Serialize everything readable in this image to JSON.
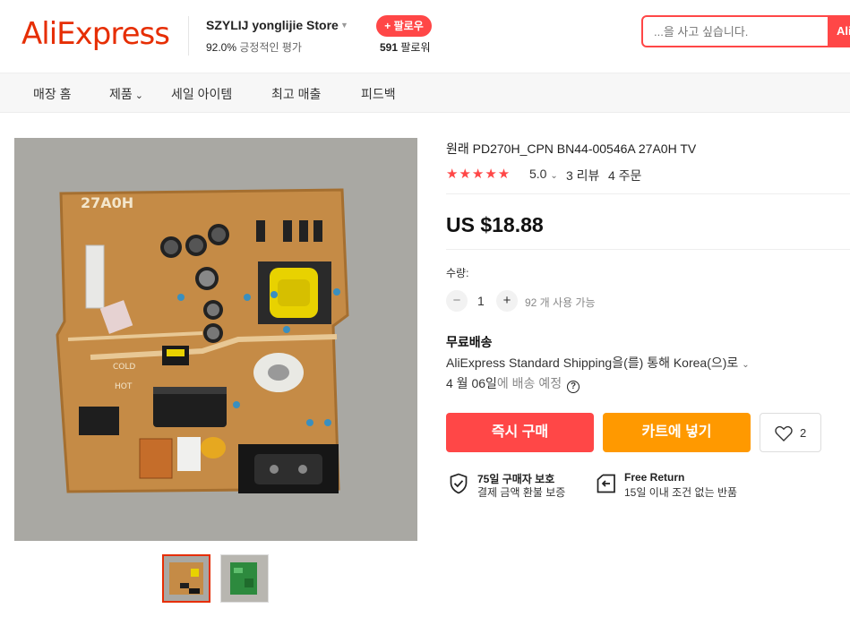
{
  "header": {
    "logo": "AliExpress",
    "store_name": "SZYLIJ yonglijie Store",
    "store_rating_value": "92.0%",
    "store_rating_label": "긍정적인 평가",
    "follow_label": "+ 팔로우",
    "followers_count": "591",
    "followers_label": "팔로워",
    "search_placeholder": "...을 사고 싶습니다.",
    "search_button": "Ali"
  },
  "nav": {
    "items": [
      "매장 홈",
      "제품",
      "세일 아이템",
      "최고 매출",
      "피드백"
    ]
  },
  "product": {
    "title": "원래 PD270H_CPN BN44-00546A 27A0H TV",
    "stars": "★★★★★",
    "rating": "5.0",
    "reviews": "3 리뷰",
    "orders": "4 주문",
    "price": "US $18.88",
    "quantity_label": "수량:",
    "quantity_minus": "−",
    "quantity_value": "1",
    "quantity_plus": "+",
    "quantity_available": "92 개 사용 가능",
    "shipping_title": "무료배송",
    "shipping_desc": "AliExpress Standard Shipping을(를) 통해 Korea(으)로",
    "shipping_date": "4 월 06일",
    "shipping_date_suffix": "에 배송 예정",
    "buy_now": "즉시 구매",
    "add_to_cart": "카트에 넣기",
    "wishlist_count": "2",
    "board_label": "27A0H",
    "board_cold_label": "COLD",
    "board_hot_label": "HOT",
    "guarantees": [
      {
        "title": "75일 구매자 보호",
        "sub": "결제 금액 환불 보증",
        "icon": "shield-check-icon"
      },
      {
        "title": "Free Return",
        "sub": "15일 이내 조건 없는 반품",
        "icon": "return-icon"
      }
    ]
  },
  "colors": {
    "brand": "#e62e04",
    "buy": "#ff4747",
    "cart": "#ff9900",
    "star": "#ff4747"
  }
}
